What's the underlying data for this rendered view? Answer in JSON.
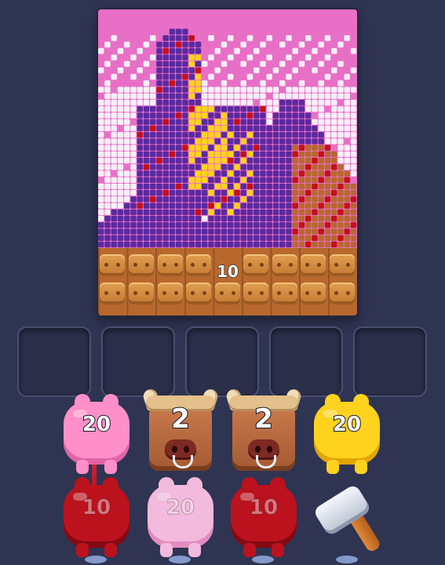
{
  "board": {
    "ground_count": "10"
  },
  "palette": {
    "pink": "#e86fc6",
    "white": "#f7eef8",
    "purple": "#5a2aa0",
    "yellow": "#ffd21e",
    "red": "#c4101a",
    "brown": "#b8682d"
  },
  "shooters": {
    "top": [
      {
        "type": "pig",
        "color": "pink",
        "count": "20"
      },
      {
        "type": "bull",
        "count": "2"
      },
      {
        "type": "bull",
        "count": "2"
      },
      {
        "type": "pig",
        "color": "yellow",
        "count": "20"
      }
    ],
    "bottom": [
      {
        "type": "pig",
        "color": "red",
        "count": "10"
      },
      {
        "type": "pig",
        "color": "lightpink",
        "count": "20"
      },
      {
        "type": "pig",
        "color": "red",
        "count": "10"
      },
      {
        "type": "tool",
        "icon": "hammer-icon"
      }
    ]
  }
}
